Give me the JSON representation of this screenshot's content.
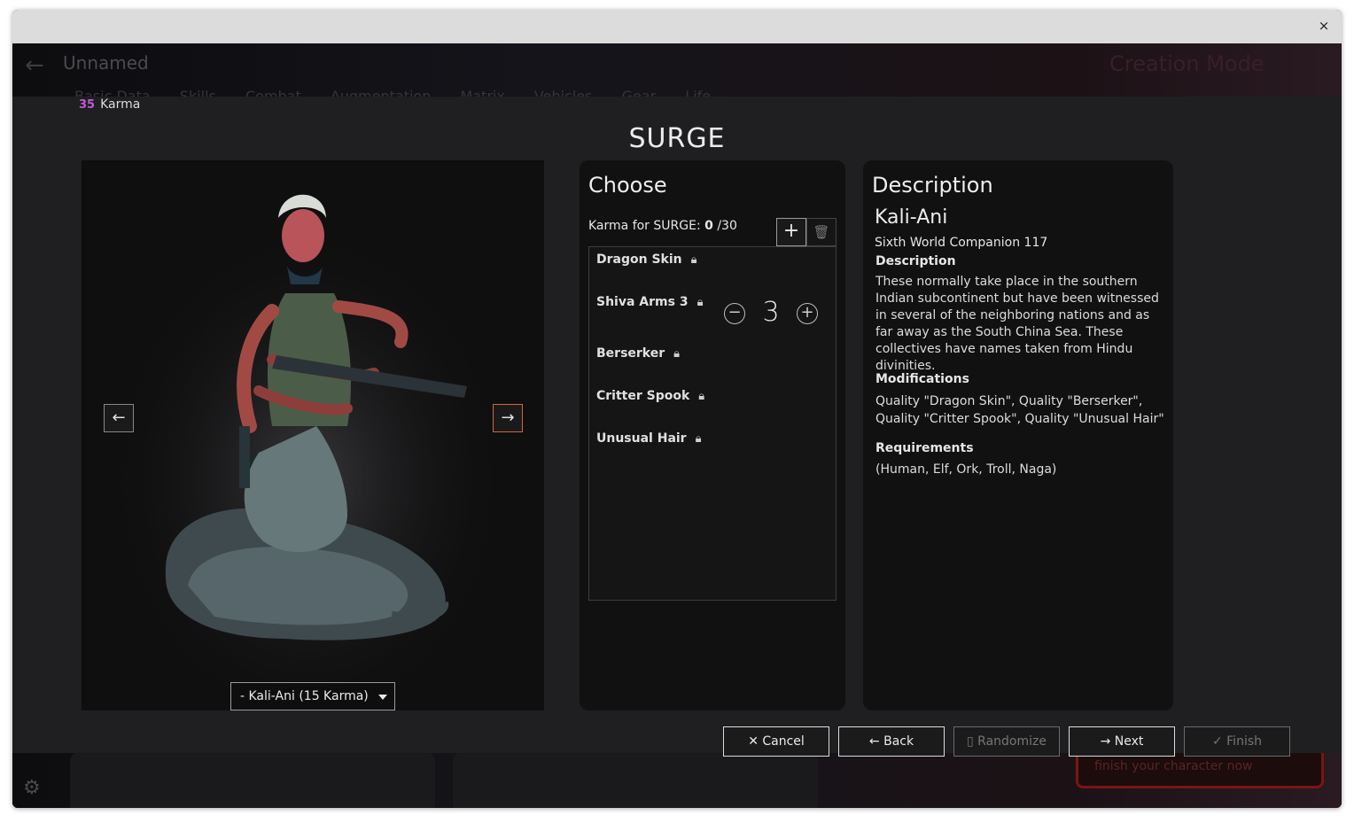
{
  "window": {
    "close_label": "×"
  },
  "background_app": {
    "back_icon": "←",
    "title": "Unnamed",
    "mode": "Creation Mode",
    "tabs": [
      "Basic Data",
      "Skills",
      "Combat",
      "Augmentation",
      "Matrix",
      "Vehicles",
      "Gear",
      "Life"
    ],
    "finish_hint": "finish your character now"
  },
  "karma": {
    "value": "35",
    "label": "Karma"
  },
  "modal": {
    "title": "SURGE"
  },
  "image_panel": {
    "prev_icon": "←",
    "next_icon": "→",
    "selected_variant": "- Kali-Ani (15 Karma)"
  },
  "choose": {
    "heading": "Choose",
    "karma_label": "Karma for SURGE:",
    "karma_spent": "0",
    "karma_max": "/30",
    "add_icon": "+",
    "delete_icon": "🗑",
    "items": [
      {
        "label": "Dragon Skin",
        "locked": true
      },
      {
        "label": "Shiva Arms 3",
        "locked": true,
        "value": "3"
      },
      {
        "label": "Berserker",
        "locked": true
      },
      {
        "label": "Critter Spook",
        "locked": true
      },
      {
        "label": "Unusual Hair",
        "locked": true
      }
    ],
    "stepper": {
      "minus": "−",
      "plus": "+",
      "value": "3"
    }
  },
  "description": {
    "heading": "Description",
    "name": "Kali-Ani",
    "source": "Sixth World Companion 117",
    "desc_label": "Description",
    "desc_text": "These normally take place in the southern Indian subcontinent but have been witnessed in several of the neighboring nations and as far away as the South China Sea. These collectives have names taken from Hindu divinities.",
    "mods_label": "Modifications",
    "mods_text": "Quality \"Dragon Skin\", Quality \"Berserker\", Quality \"Critter Spook\", Quality \"Unusual Hair\"",
    "req_label": "Requirements",
    "req_text": "(Human, Elf, Ork, Troll, Naga)"
  },
  "footer": {
    "cancel": "✕ Cancel",
    "back": "← Back",
    "randomize": "▯ Randomize",
    "next": "→ Next",
    "finish": "✓ Finish"
  },
  "colors": {
    "accent_karma": "#c25ad6",
    "next_arrow_border": "#d0663e"
  }
}
